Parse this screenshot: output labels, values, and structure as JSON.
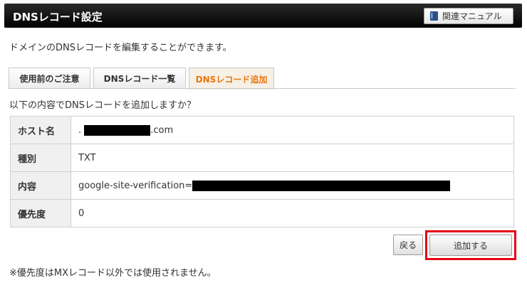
{
  "header": {
    "title": "DNSレコード設定",
    "manual_button": "関連マニュアル"
  },
  "description": "ドメインのDNSレコードを編集することができます。",
  "tabs": [
    {
      "label": "使用前のご注意",
      "active": false
    },
    {
      "label": "DNSレコード一覧",
      "active": false
    },
    {
      "label": "DNSレコード追加",
      "active": true
    }
  ],
  "question": "以下の内容でDNSレコードを追加しますか？",
  "record": {
    "hostname": {
      "label": "ホスト名",
      "prefix": ".",
      "suffix": ".com"
    },
    "type": {
      "label": "種別",
      "value": "TXT"
    },
    "content": {
      "label": "内容",
      "value": "google-site-verification="
    },
    "priority": {
      "label": "優先度",
      "value": "0"
    }
  },
  "buttons": {
    "back": "戻る",
    "add": "追加する"
  },
  "footnote": "※優先度はMXレコード以外では使用されません。",
  "colors": {
    "header_bg": "#000000",
    "active_tab_text": "#e8760d",
    "highlight_border": "#e60012"
  }
}
